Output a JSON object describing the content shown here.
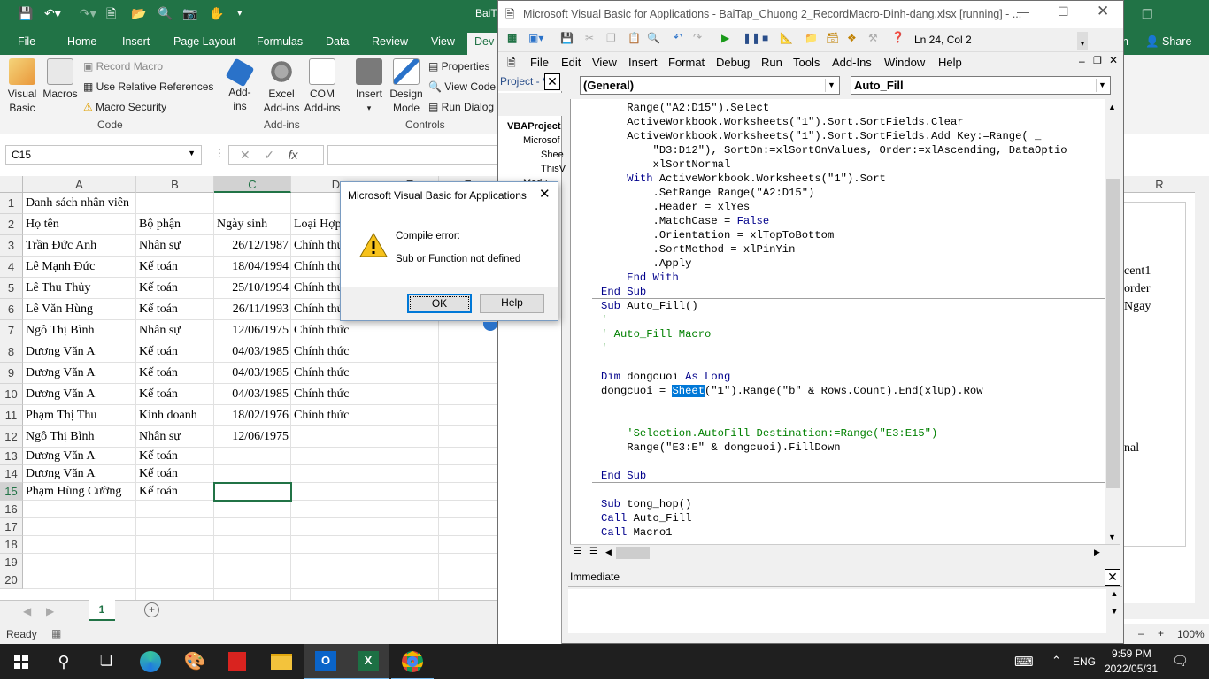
{
  "excel": {
    "qat_title": "BaiTa",
    "tabs": [
      "File",
      "Home",
      "Insert",
      "Page Layout",
      "Formulas",
      "Data",
      "Review",
      "View",
      "Dev",
      "n",
      "Share"
    ],
    "ribbon": {
      "visual_basic": "Visual\nBasic",
      "macros": "Macros",
      "record_macro": "Record Macro",
      "relative_refs": "Use Relative References",
      "macro_security": "Macro Security",
      "addins": "Add-\nins",
      "excel_addins": "Excel\nAdd-ins",
      "com_addins": "COM\nAdd-ins",
      "insert": "Insert",
      "design_mode": "Design\nMode",
      "properties": "Properties",
      "view_code": "View Code",
      "run_dialog": "Run Dialog",
      "groups": [
        "Code",
        "Add-ins",
        "Controls"
      ]
    },
    "name_box": "C15",
    "fx": "fx",
    "columns": [
      "A",
      "B",
      "C",
      "D",
      "E",
      "F",
      "R"
    ],
    "rows": [
      {
        "n": "1",
        "a": "Danh sách nhân viên",
        "b": "",
        "c": "",
        "d": ""
      },
      {
        "n": "2",
        "a": "Họ tên",
        "b": "Bộ phận",
        "c": "Ngày sinh",
        "d": "Loại Hợp"
      },
      {
        "n": "3",
        "a": "Trần Đức Anh",
        "b": "Nhân sự",
        "c": "26/12/1987",
        "d": "Chính thức"
      },
      {
        "n": "4",
        "a": "Lê Mạnh Đức",
        "b": "Kế toán",
        "c": "18/04/1994",
        "d": "Chính thức"
      },
      {
        "n": "5",
        "a": "Lê Thu Thủy",
        "b": "Kế toán",
        "c": "25/10/1994",
        "d": "Chính thức"
      },
      {
        "n": "6",
        "a": "Lê Văn Hùng",
        "b": "Kế toán",
        "c": "26/11/1993",
        "d": "Chính thức"
      },
      {
        "n": "7",
        "a": "Ngô Thị Bình",
        "b": "Nhân sự",
        "c": "12/06/1975",
        "d": "Chính thức"
      },
      {
        "n": "8",
        "a": "Dương Văn A",
        "b": "Kế toán",
        "c": "04/03/1985",
        "d": "Chính thức"
      },
      {
        "n": "9",
        "a": "Dương Văn A",
        "b": "Kế toán",
        "c": "04/03/1985",
        "d": "Chính thức"
      },
      {
        "n": "10",
        "a": "Dương Văn A",
        "b": "Kế toán",
        "c": "04/03/1985",
        "d": "Chính thức"
      },
      {
        "n": "11",
        "a": "Phạm Thị Thu",
        "b": "Kinh doanh",
        "c": "18/02/1976",
        "d": "Chính thức"
      },
      {
        "n": "12",
        "a": "Ngô Thị Bình",
        "b": "Nhân sự",
        "c": "12/06/1975",
        "d": ""
      },
      {
        "n": "13",
        "a": "Dương Văn A",
        "b": "Kế toán",
        "c": "",
        "d": ""
      },
      {
        "n": "14",
        "a": "Dương Văn A",
        "b": "Kế toán",
        "c": "",
        "d": ""
      },
      {
        "n": "15",
        "a": "Phạm Hùng Cường",
        "b": "Kế toán",
        "c": "",
        "d": ""
      },
      {
        "n": "16",
        "a": "",
        "b": "",
        "c": "",
        "d": ""
      },
      {
        "n": "17",
        "a": "",
        "b": "",
        "c": "",
        "d": ""
      },
      {
        "n": "18",
        "a": "",
        "b": "",
        "c": "",
        "d": ""
      },
      {
        "n": "19",
        "a": "",
        "b": "",
        "c": "",
        "d": ""
      },
      {
        "n": "20",
        "a": "",
        "b": "",
        "c": "",
        "d": ""
      }
    ],
    "right_peek": [
      "cent1",
      "order",
      "Ngay",
      "nal"
    ],
    "sheet_tab": "1",
    "status": "Ready",
    "zoom": "100%"
  },
  "vba": {
    "title": "Microsoft Visual Basic for Applications - BaiTap_Chuong 2_RecordMacro-Dinh-dang.xlsx [running] - ...",
    "position": "Ln 24, Col 2",
    "menu": [
      "File",
      "Edit",
      "View",
      "Insert",
      "Format",
      "Debug",
      "Run",
      "Tools",
      "Add-Ins",
      "Window",
      "Help"
    ],
    "project_title": "Project - V",
    "project_tree": [
      "VBAProject",
      "Microsof",
      "Shee",
      "ThisV",
      "Modu"
    ],
    "object_dd": "(General)",
    "proc_dd": "Auto_Fill",
    "immediate_title": "Immediate",
    "code_lines": [
      {
        "t": "    Range(\"A2:D15\").Select",
        "c": ""
      },
      {
        "t": "    ActiveWorkbook.Worksheets(\"1\").Sort.SortFields.Clear",
        "c": ""
      },
      {
        "t": "    ActiveWorkbook.Worksheets(\"1\").Sort.SortFields.Add Key:=Range( _",
        "c": ""
      },
      {
        "t": "        \"D3:D12\"), SortOn:=xlSortOnValues, Order:=xlAscending, DataOptio",
        "c": ""
      },
      {
        "t": "        xlSortNormal",
        "c": ""
      },
      {
        "t": "    With ActiveWorkbook.Worksheets(\"1\").Sort",
        "c": "w"
      },
      {
        "t": "        .SetRange Range(\"A2:D15\")",
        "c": ""
      },
      {
        "t": "        .Header = xlYes",
        "c": ""
      },
      {
        "t": "        .MatchCase = False",
        "c": "f"
      },
      {
        "t": "        .Orientation = xlTopToBottom",
        "c": ""
      },
      {
        "t": "        .SortMethod = xlPinYin",
        "c": ""
      },
      {
        "t": "        .Apply",
        "c": ""
      },
      {
        "t": "    End With",
        "c": "k"
      },
      {
        "t": "End Sub",
        "c": "k"
      },
      {
        "t": "Sub Auto_Fill()",
        "c": "s"
      },
      {
        "t": "'",
        "c": "cm"
      },
      {
        "t": "' Auto_Fill Macro",
        "c": "cm"
      },
      {
        "t": "'",
        "c": "cm"
      },
      {
        "t": "",
        "c": ""
      },
      {
        "t": "Dim dongcuoi As Long",
        "c": "dim"
      },
      {
        "t": "dongcuoi = Sheet(\"1\").Range(\"b\" & Rows.Count).End(xlUp).Row",
        "c": "sel"
      },
      {
        "t": "",
        "c": ""
      },
      {
        "t": "",
        "c": ""
      },
      {
        "t": "    'Selection.AutoFill Destination:=Range(\"E3:E15\")",
        "c": "cm"
      },
      {
        "t": "    Range(\"E3:E\" & dongcuoi).FillDown",
        "c": ""
      },
      {
        "t": "",
        "c": ""
      },
      {
        "t": "End Sub",
        "c": "k"
      },
      {
        "t": "",
        "c": ""
      },
      {
        "t": "Sub tong_hop()",
        "c": "s"
      },
      {
        "t": "Call Auto_Fill",
        "c": "call"
      },
      {
        "t": "Call Macro1",
        "c": "call"
      }
    ]
  },
  "dialog": {
    "title": "Microsoft Visual Basic for Applications",
    "line1": "Compile error:",
    "line2": "Sub or Function not defined",
    "ok": "OK",
    "help": "Help"
  },
  "taskbar": {
    "lang": "ENG",
    "time": "9:59 PM",
    "date": "2022/05/31"
  }
}
